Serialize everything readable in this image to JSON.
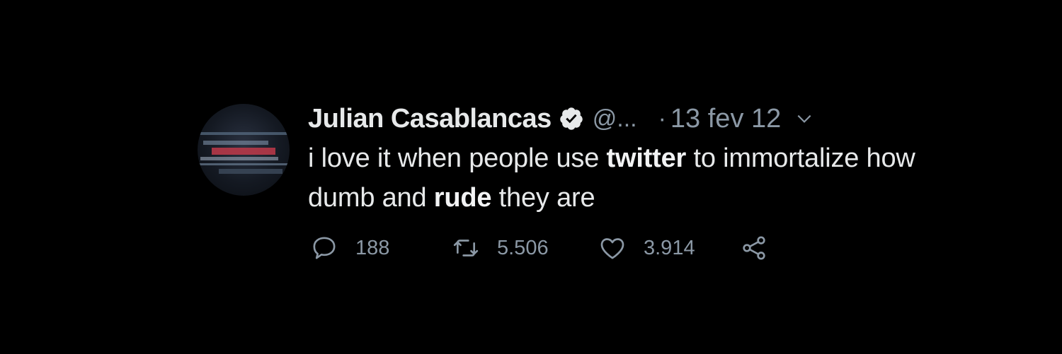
{
  "tweet": {
    "author_name": "Julian Casablancas",
    "handle": "@...",
    "separator": "·",
    "date": "13 fev 12",
    "text_parts": {
      "p1": "i love it when people use ",
      "p2": "twitter",
      "p3": " to immortalize how dumb and ",
      "p4": "rude",
      "p5": " they are"
    },
    "stats": {
      "replies": "188",
      "retweets": "5.506",
      "likes": "3.914"
    }
  },
  "icons": {
    "verified": "verified-badge-icon",
    "chevron": "chevron-down-icon",
    "reply": "reply-icon",
    "retweet": "retweet-icon",
    "like": "heart-icon",
    "share": "share-icon"
  },
  "colors": {
    "background": "#000000",
    "primary_text": "#e7e9ea",
    "secondary_text": "#8b98a5"
  }
}
